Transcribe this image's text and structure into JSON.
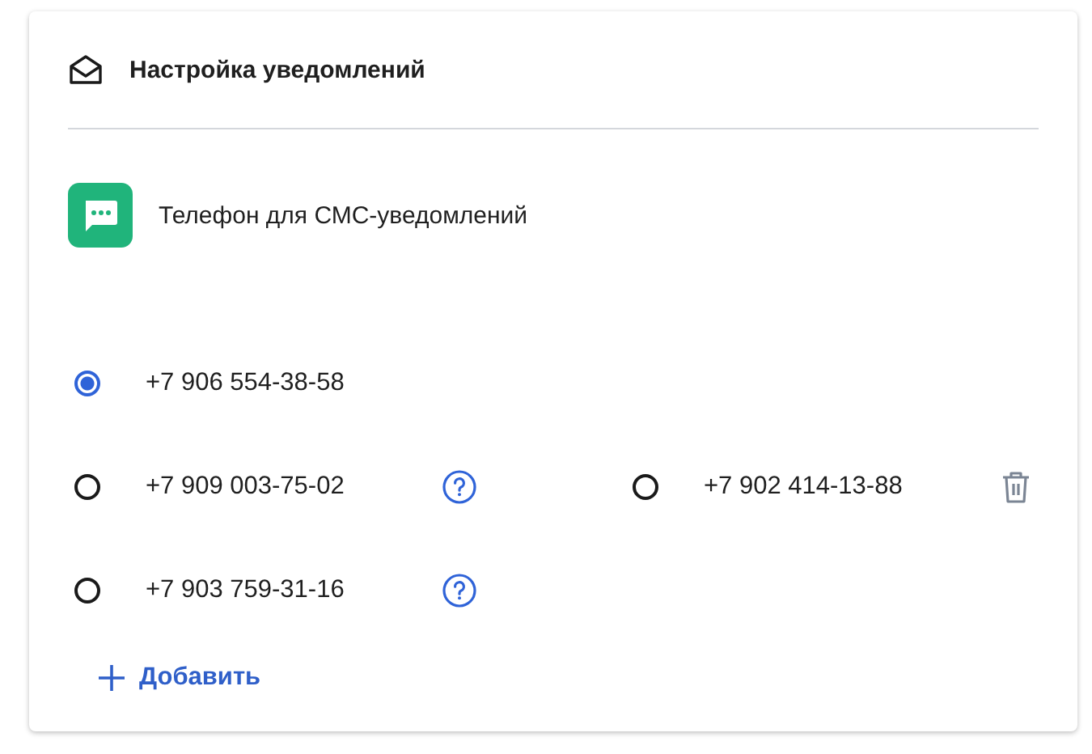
{
  "card": {
    "title": "Настройка уведомлений"
  },
  "section": {
    "label": "Телефон для СМС-уведомлений"
  },
  "rows": [
    {
      "phones": [
        {
          "number": "+7 906 554-38-58",
          "selected": true
        }
      ]
    },
    {
      "phones": [
        {
          "number": "+7 909 003-75-02",
          "selected": false,
          "kind": "help"
        },
        {
          "number": "+7 902 414-13-88",
          "selected": false,
          "kind": "delete"
        }
      ]
    },
    {
      "phones": [
        {
          "number": "+7 903 759-31-16",
          "selected": false,
          "kind": "help"
        }
      ]
    }
  ],
  "add_button": {
    "label": "Добавить"
  }
}
